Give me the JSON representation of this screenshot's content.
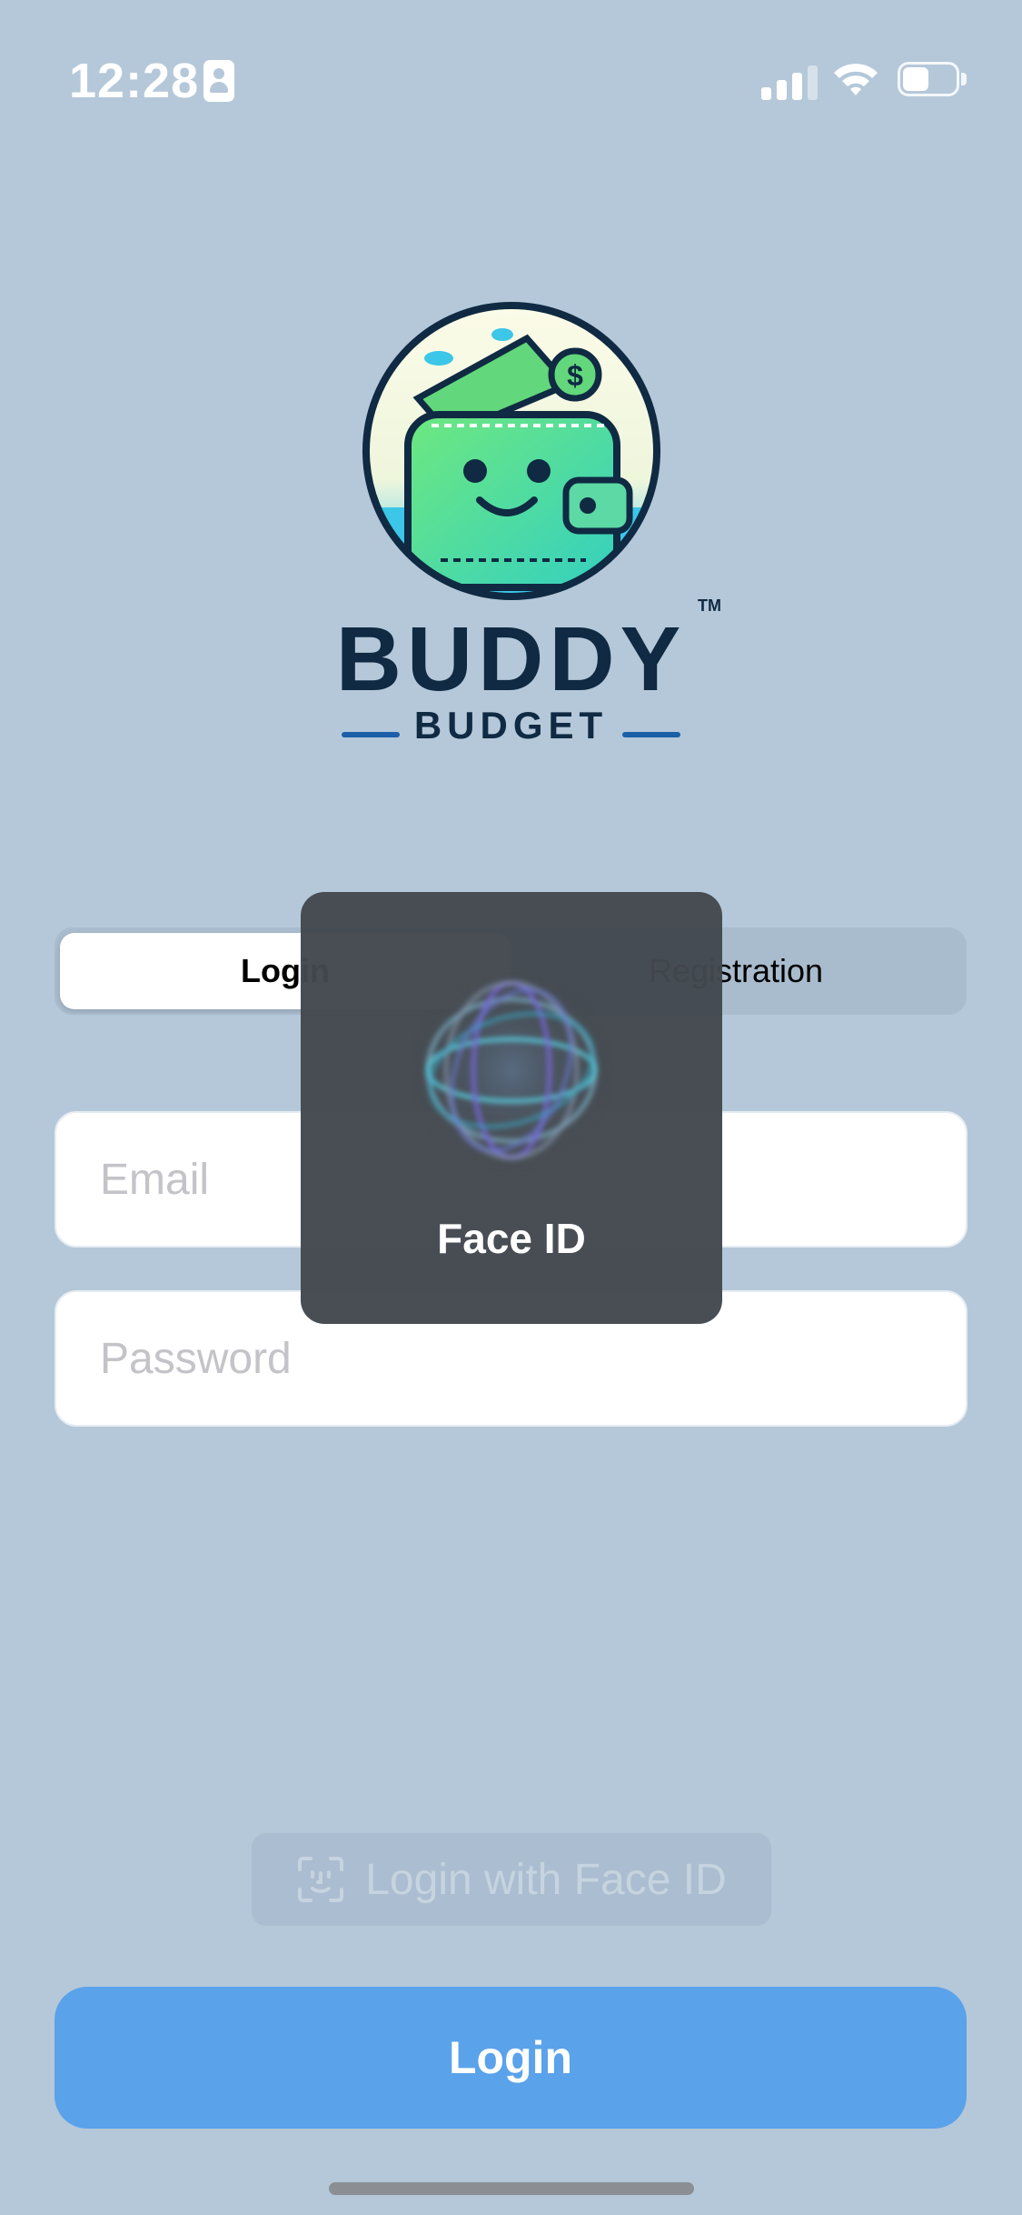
{
  "status_bar": {
    "time": "12:28"
  },
  "brand": {
    "title": "BUDDY",
    "subtitle": "BUDGET",
    "trademark": "TM"
  },
  "segmented": {
    "login_label": "Login",
    "registration_label": "Registration"
  },
  "form": {
    "email_placeholder": "Email",
    "password_placeholder": "Password"
  },
  "faceid_button": {
    "label": "Login with Face ID"
  },
  "login_button": {
    "label": "Login"
  },
  "faceid_overlay": {
    "label": "Face ID"
  },
  "colors": {
    "background": "#b4c8d9",
    "accent": "#5aa2ea",
    "brand_dark": "#0f2a42"
  }
}
